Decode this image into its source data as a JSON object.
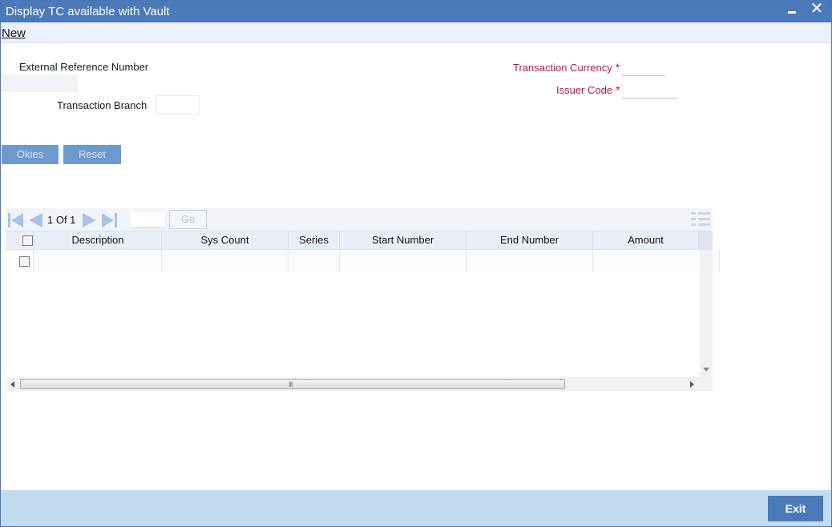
{
  "window": {
    "title": "Display TC available with Vault",
    "close_glyph": "✕"
  },
  "menu": {
    "new_label": "New"
  },
  "form": {
    "external_reference_number_label": "External Reference Number",
    "external_reference_number_value": "",
    "transaction_branch_label": "Transaction Branch",
    "transaction_branch_value": "",
    "transaction_currency_label": "Transaction Currency",
    "transaction_currency_value": "",
    "issuer_code_label": "Issuer Code",
    "issuer_code_value": "",
    "required_mark": "*"
  },
  "actions": {
    "okies_label": "Okies",
    "reset_label": "Reset"
  },
  "grid": {
    "page_info": "1 Of 1",
    "goto_value": "",
    "go_label": "Go",
    "columns": [
      "Description",
      "Sys Count",
      "Series",
      "Start Number",
      "End Number",
      "Amount"
    ],
    "rows": [
      {
        "description": "",
        "sys_count": "",
        "series": "",
        "start_number": "",
        "end_number": "",
        "amount": ""
      }
    ],
    "hscroll_grip": "III"
  },
  "footer": {
    "exit_label": "Exit"
  },
  "colors": {
    "title_bar": "#4a7ab9",
    "required_label": "#c0163a",
    "button_disabled": "#6d99d0",
    "footer_bg": "#c3dbee"
  },
  "icons": {
    "minimize": "minimize-icon",
    "close": "close-icon",
    "first_page": "first-page-icon",
    "prev_page": "previous-page-icon",
    "next_page": "next-page-icon",
    "last_page": "last-page-icon",
    "column_selector": "column-selector-icon"
  }
}
